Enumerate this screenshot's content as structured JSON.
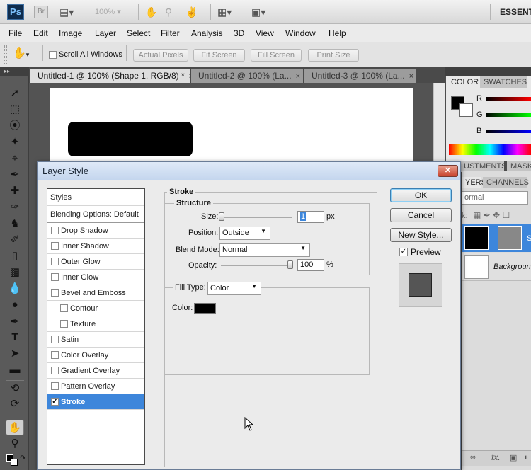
{
  "appbar": {
    "logo": "Ps",
    "bridge": "Br",
    "zoom": "100%",
    "workspace": "ESSENTI"
  },
  "menu": [
    "File",
    "Edit",
    "Image",
    "Layer",
    "Select",
    "Filter",
    "Analysis",
    "3D",
    "View",
    "Window",
    "Help"
  ],
  "options": {
    "scroll_all": "Scroll All Windows",
    "actual_pixels": "Actual Pixels",
    "fit_screen": "Fit Screen",
    "fill_screen": "Fill Screen",
    "print_size": "Print Size"
  },
  "tabs": [
    {
      "label": "Untitled-1 @ 100% (Shape 1, RGB/8) *",
      "close": "×"
    },
    {
      "label": "Untitled-2 @ 100% (La...",
      "close": "×"
    },
    {
      "label": "Untitled-3 @ 100% (La...",
      "close": "×"
    }
  ],
  "panels": {
    "color_tab": "COLOR",
    "swatches_tab": "SWATCHES",
    "r": "R",
    "g": "G",
    "b": "B",
    "adjustments_tab": "USTMENTS",
    "masks_tab": "MASK",
    "layers_tab": "YERS",
    "channels_tab": "CHANNELS",
    "blend_mode": "ormal",
    "lock_label": "k:",
    "layer1_name": "S",
    "layer2_name": "Backgroun",
    "footer_fx": "fx."
  },
  "dialog": {
    "title": "Layer Style",
    "close": "✕",
    "styles_header": "Styles",
    "blending_options": "Blending Options: Default",
    "items": [
      {
        "label": "Drop Shadow",
        "checked": false
      },
      {
        "label": "Inner Shadow",
        "checked": false
      },
      {
        "label": "Outer Glow",
        "checked": false
      },
      {
        "label": "Inner Glow",
        "checked": false
      },
      {
        "label": "Bevel and Emboss",
        "checked": false
      },
      {
        "label": "Contour",
        "checked": false,
        "sub": true
      },
      {
        "label": "Texture",
        "checked": false,
        "sub": true
      },
      {
        "label": "Satin",
        "checked": false
      },
      {
        "label": "Color Overlay",
        "checked": false
      },
      {
        "label": "Gradient Overlay",
        "checked": false
      },
      {
        "label": "Pattern Overlay",
        "checked": false
      },
      {
        "label": "Stroke",
        "checked": true,
        "selected": true
      }
    ],
    "stroke_title": "Stroke",
    "structure_title": "Structure",
    "size_label": "Size:",
    "size_value": "1",
    "size_unit": "px",
    "position_label": "Position:",
    "position_value": "Outside",
    "blend_label": "Blend Mode:",
    "blend_value": "Normal",
    "opacity_label": "Opacity:",
    "opacity_value": "100",
    "opacity_unit": "%",
    "fill_type_label": "Fill Type:",
    "fill_type_value": "Color",
    "color_label": "Color:",
    "ok": "OK",
    "cancel": "Cancel",
    "new_style": "New Style...",
    "preview": "Preview",
    "check": "✓"
  }
}
